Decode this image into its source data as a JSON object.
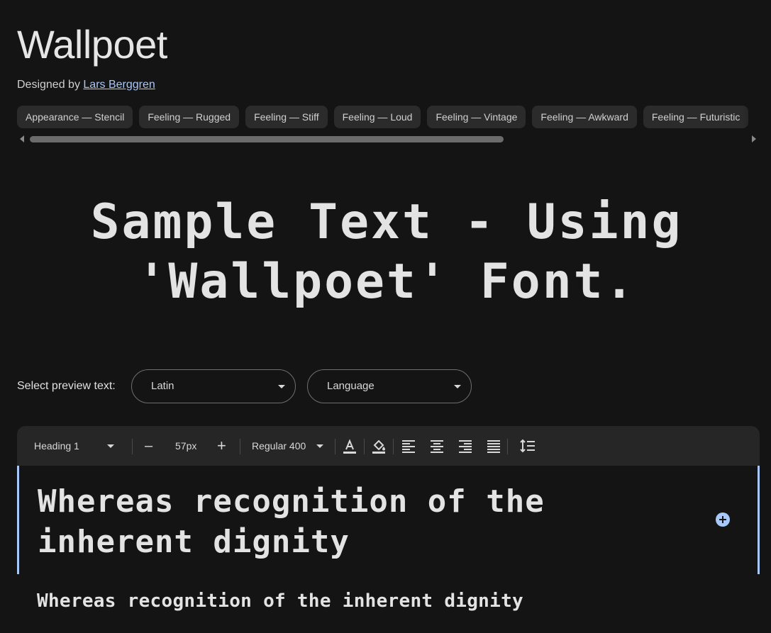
{
  "header": {
    "title": "Wallpoet",
    "designed_by_prefix": "Designed by",
    "designer_name": "Lars Berggren"
  },
  "tags": [
    "Appearance — Stencil",
    "Feeling — Rugged",
    "Feeling — Stiff",
    "Feeling — Loud",
    "Feeling — Vintage",
    "Feeling — Awkward",
    "Feeling — Futuristic"
  ],
  "sample_text": "Sample Text - Using 'Wallpoet' Font.",
  "preview": {
    "label": "Select preview text:",
    "script_value": "Latin",
    "language_placeholder": "Language"
  },
  "toolbar": {
    "style_value": "Heading 1",
    "size_value": "57px",
    "weight_value": "Regular 400",
    "decrease_label": "–",
    "increase_label": "+",
    "icons": [
      "text-color-icon",
      "fill-color-icon",
      "align-left-icon",
      "align-center-icon",
      "align-right-icon",
      "align-justify-icon",
      "line-height-icon"
    ]
  },
  "editor": {
    "text": "Whereas recognition of the inherent dignity"
  },
  "secondary_preview": {
    "text": "Whereas recognition of the inherent dignity"
  },
  "colors": {
    "background": "#141414",
    "accent": "#a8c7fa",
    "chip": "#2b2b2b",
    "toolbar": "#262626"
  }
}
